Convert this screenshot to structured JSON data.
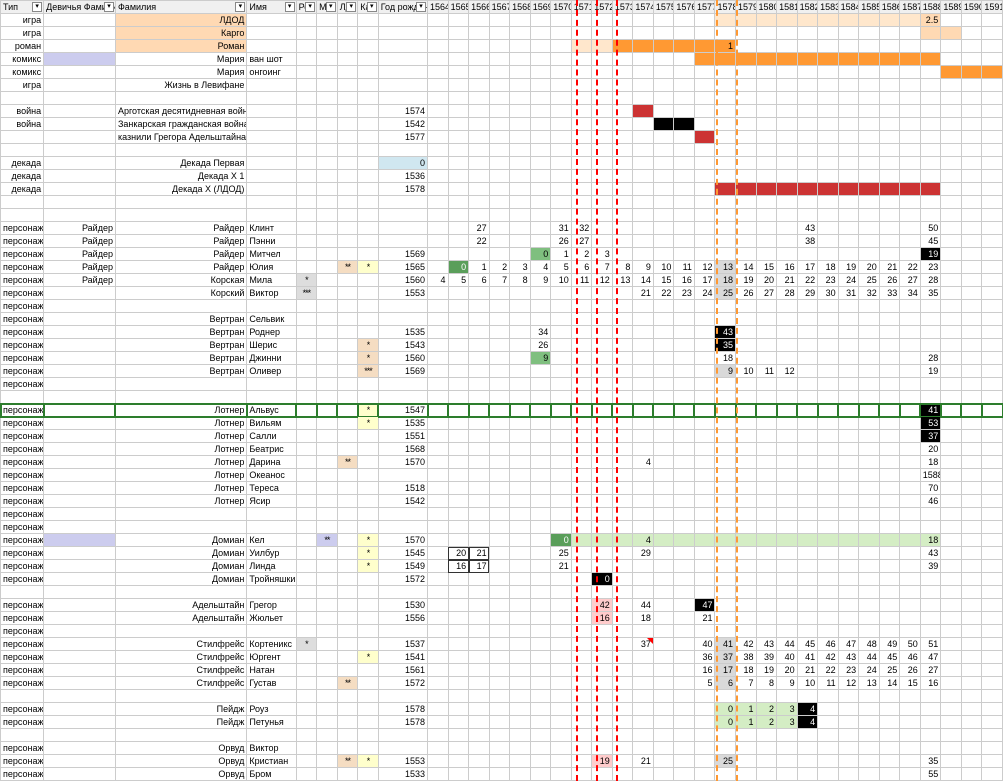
{
  "headers": [
    "Тип",
    "Девичья Фамилия",
    "Фамилия",
    "Имя",
    "Рок",
    "Ма",
    "ЛД",
    "Ка",
    "Год рожден"
  ],
  "years": [
    "1564",
    "1565",
    "1566",
    "1567",
    "1568",
    "1569",
    "1570",
    "1571",
    "1572",
    "1573",
    "1574",
    "1575",
    "1576",
    "1577",
    "1578",
    "1579",
    "1580",
    "1581",
    "1582",
    "1583",
    "1584",
    "1585",
    "1586",
    "1587",
    "1588",
    "1589",
    "1590",
    "1591"
  ],
  "rows": [
    {
      "t": "игра",
      "fam": "ЛДОД",
      "fcls": "bg-peach",
      "yr": {
        "1588": {
          "v": "2.5",
          "cls": "bg-peach"
        }
      },
      "span1": {
        "from": "1578",
        "to": "1587",
        "cls": "bg-peach2"
      }
    },
    {
      "t": "игра",
      "fam": "Карго",
      "fcls": "bg-peach",
      "span1": {
        "from": "1588",
        "to": "1589",
        "cls": "bg-peach"
      }
    },
    {
      "t": "роман",
      "fam": "Роман",
      "fcls": "bg-peach",
      "yr": {
        "1578": {
          "v": "1",
          "cls": "bg-orange"
        }
      },
      "span1": {
        "from": "1573",
        "to": "1577",
        "cls": "bg-orange"
      },
      "span0": {
        "from": "1571",
        "to": "1572",
        "cls": "bg-peach2"
      }
    },
    {
      "t": "комикс",
      "mfcls": "bg-lav",
      "fam": "Мария",
      "name": "ван шот",
      "span1": {
        "from": "1577",
        "to": "1588",
        "cls": "bg-orange"
      }
    },
    {
      "t": "комикс",
      "fam": "Мария",
      "name": "онгоинг",
      "span1": {
        "from": "1589",
        "to": "1591",
        "cls": "bg-orange"
      }
    },
    {
      "t": "игра",
      "fam": "Жизнь в Левифане"
    },
    {
      "t": ""
    },
    {
      "t": "война",
      "fam": "Арготская десятидневная война",
      "by": "1574",
      "span1": {
        "from": "1574",
        "to": "1574",
        "cls": "bg-red"
      }
    },
    {
      "t": "война",
      "fam": "Занкарская гражданская война",
      "by": "1542",
      "span1": {
        "from": "1575",
        "to": "1576",
        "cls": "bg-black"
      }
    },
    {
      "t": "",
      "fam": "казнили Грегора Адельштайна",
      "by": "1577",
      "span1": {
        "from": "1577",
        "to": "1577",
        "cls": "bg-red"
      }
    },
    {
      "t": ""
    },
    {
      "t": "декада",
      "fam": "Декада Первая",
      "by": "0",
      "bycls": "bg-lblue"
    },
    {
      "t": "декада",
      "fam": "Декада X 1",
      "by": "1536"
    },
    {
      "t": "декада",
      "fam": "Декада X (ЛДОД)",
      "by": "1578",
      "span1": {
        "from": "1578",
        "to": "1588",
        "cls": "bg-red"
      }
    },
    {
      "t": ""
    },
    {
      "t": ""
    },
    {
      "t": "персонаж",
      "mf": "Райдер",
      "fam": "Райдер",
      "name": "Клинт",
      "yr": {
        "1566": {
          "v": "27"
        },
        "1570": {
          "v": "31"
        },
        "1571": {
          "v": "32"
        },
        "1582": {
          "v": "43"
        },
        "1588": {
          "v": "50"
        }
      }
    },
    {
      "t": "персонаж",
      "mf": "Райдер",
      "fam": "Райдер",
      "name": "Пэнни",
      "yr": {
        "1566": {
          "v": "22"
        },
        "1570": {
          "v": "26"
        },
        "1571": {
          "v": "27"
        },
        "1582": {
          "v": "38"
        },
        "1588": {
          "v": "45"
        }
      }
    },
    {
      "t": "персонаж",
      "mf": "Райдер",
      "fam": "Райдер",
      "name": "Митчел",
      "by": "1569",
      "yr": {
        "1569": {
          "v": "0",
          "cls": "bg-green"
        },
        "1570": {
          "v": "1"
        },
        "1571": {
          "v": "2"
        },
        "1572": {
          "v": "3"
        },
        "1588": {
          "v": "19",
          "cls": "bg-black"
        }
      }
    },
    {
      "t": "персонаж",
      "mf": "Райдер",
      "fam": "Райдер",
      "name": "Юлия",
      "ld": "**",
      "ldcls": "bg-beige",
      "ka": "*",
      "kacls": "bg-yellow",
      "by": "1565",
      "yr": {
        "1565": {
          "v": "0",
          "cls": "bg-dgreen"
        },
        "1566": {
          "v": "1"
        },
        "1567": {
          "v": "2"
        },
        "1568": {
          "v": "3"
        },
        "1569": {
          "v": "4"
        },
        "1570": {
          "v": "5"
        },
        "1571": {
          "v": "6"
        },
        "1572": {
          "v": "7"
        },
        "1573": {
          "v": "8"
        },
        "1574": {
          "v": "9"
        },
        "1575": {
          "v": "10"
        },
        "1576": {
          "v": "11"
        },
        "1577": {
          "v": "12"
        },
        "1578": {
          "v": "13",
          "cls": "bg-greyf"
        },
        "1579": {
          "v": "14"
        },
        "1580": {
          "v": "15"
        },
        "1581": {
          "v": "16"
        },
        "1582": {
          "v": "17"
        },
        "1583": {
          "v": "18"
        },
        "1584": {
          "v": "19"
        },
        "1585": {
          "v": "20"
        },
        "1586": {
          "v": "21"
        },
        "1587": {
          "v": "22"
        },
        "1588": {
          "v": "23"
        }
      }
    },
    {
      "t": "персонаж",
      "mf": "Райдер",
      "fam": "Корская",
      "name": "Мила",
      "pok": "*",
      "pokcls": "bg-grey",
      "by": "1560",
      "yr": {
        "1564": {
          "v": "4"
        },
        "1565": {
          "v": "5"
        },
        "1566": {
          "v": "6"
        },
        "1567": {
          "v": "7"
        },
        "1568": {
          "v": "8"
        },
        "1569": {
          "v": "9"
        },
        "1570": {
          "v": "10"
        },
        "1571": {
          "v": "11"
        },
        "1572": {
          "v": "12"
        },
        "1573": {
          "v": "13"
        },
        "1574": {
          "v": "14"
        },
        "1575": {
          "v": "15"
        },
        "1576": {
          "v": "16"
        },
        "1577": {
          "v": "17"
        },
        "1578": {
          "v": "18",
          "cls": "bg-greyf"
        },
        "1579": {
          "v": "19"
        },
        "1580": {
          "v": "20"
        },
        "1581": {
          "v": "21"
        },
        "1582": {
          "v": "22"
        },
        "1583": {
          "v": "23"
        },
        "1584": {
          "v": "24"
        },
        "1585": {
          "v": "25"
        },
        "1586": {
          "v": "26"
        },
        "1587": {
          "v": "27"
        },
        "1588": {
          "v": "28"
        }
      }
    },
    {
      "t": "персонаж",
      "fam": "Корский",
      "name": "Виктор",
      "pok": "***",
      "pokcls": "bg-grey",
      "by": "1553",
      "yr": {
        "1574": {
          "v": "21"
        },
        "1575": {
          "v": "22"
        },
        "1576": {
          "v": "23"
        },
        "1577": {
          "v": "24"
        },
        "1578": {
          "v": "25",
          "cls": "bg-greyf"
        },
        "1579": {
          "v": "26"
        },
        "1580": {
          "v": "27"
        },
        "1581": {
          "v": "28"
        },
        "1582": {
          "v": "29"
        },
        "1583": {
          "v": "30"
        },
        "1584": {
          "v": "31"
        },
        "1585": {
          "v": "32"
        },
        "1586": {
          "v": "33"
        },
        "1587": {
          "v": "34"
        },
        "1588": {
          "v": "35"
        }
      }
    },
    {
      "t": "персонаж"
    },
    {
      "t": "персонаж",
      "fam": "Вертран",
      "name": "Сельвик"
    },
    {
      "t": "персонаж",
      "fam": "Вертран",
      "name": "Роднер",
      "by": "1535",
      "yr": {
        "1569": {
          "v": "34"
        },
        "1578": {
          "v": "43",
          "cls": "bg-black"
        }
      }
    },
    {
      "t": "персонаж",
      "fam": "Вертран",
      "name": "Шерис",
      "ka": "*",
      "kacls": "bg-beige",
      "by": "1543",
      "yr": {
        "1569": {
          "v": "26"
        },
        "1578": {
          "v": "35",
          "cls": "bg-black"
        }
      }
    },
    {
      "t": "персонаж",
      "fam": "Вертран",
      "name": "Джинни",
      "ka": "*",
      "kacls": "bg-beige",
      "by": "1560",
      "yr": {
        "1569": {
          "v": "9",
          "cls": "bg-green"
        },
        "1578": {
          "v": "18"
        },
        "1588": {
          "v": "28"
        }
      }
    },
    {
      "t": "персонаж",
      "fam": "Вертран",
      "name": "Оливер",
      "ka": "***",
      "kacls": "bg-beige",
      "by": "1569",
      "yr": {
        "1578": {
          "v": "9",
          "cls": "bg-greyf"
        },
        "1579": {
          "v": "10"
        },
        "1580": {
          "v": "11"
        },
        "1581": {
          "v": "12"
        },
        "1588": {
          "v": "19"
        }
      }
    },
    {
      "t": "персонаж"
    },
    {
      "t": ""
    },
    {
      "t": "персонаж",
      "fam": "Лотнер",
      "name": "Альвус",
      "ka": "*",
      "kacls": "bg-yellow",
      "by": "1547",
      "sel": true,
      "yr": {
        "1588": {
          "v": "41",
          "cls": "bg-black"
        }
      }
    },
    {
      "t": "персонаж",
      "fam": "Лотнер",
      "name": "Вильям",
      "ka": "*",
      "kacls": "bg-yellow",
      "by": "1535",
      "yr": {
        "1588": {
          "v": "53",
          "cls": "bg-black"
        }
      }
    },
    {
      "t": "персонаж",
      "fam": "Лотнер",
      "name": "Салли",
      "by": "1551",
      "yr": {
        "1588": {
          "v": "37",
          "cls": "bg-black"
        }
      }
    },
    {
      "t": "персонаж",
      "fam": "Лотнер",
      "name": "Беатрис",
      "by": "1568",
      "yr": {
        "1588": {
          "v": "20"
        }
      }
    },
    {
      "t": "персонаж",
      "fam": "Лотнер",
      "name": "Дарина",
      "ld": "**",
      "ldcls": "bg-beige",
      "by": "1570",
      "yr": {
        "1574": {
          "v": "4"
        },
        "1588": {
          "v": "18"
        }
      }
    },
    {
      "t": "персонаж",
      "fam": "Лотнер",
      "name": "Океанос",
      "yr": {
        "1588": {
          "v": "1588"
        }
      }
    },
    {
      "t": "персонаж",
      "fam": "Лотнер",
      "name": "Тереса",
      "by": "1518",
      "yr": {
        "1588": {
          "v": "70"
        }
      }
    },
    {
      "t": "персонаж",
      "fam": "Лотнер",
      "name": "Ясир",
      "by": "1542",
      "yr": {
        "1588": {
          "v": "46"
        }
      }
    },
    {
      "t": "персонаж"
    },
    {
      "t": "персонаж"
    },
    {
      "t": "персонаж",
      "mfcls": "bg-lav",
      "fam": "Домиан",
      "name": "Кел",
      "ma": "**",
      "macls": "bg-lav",
      "ka": "*",
      "kacls": "bg-yellow",
      "by": "1570",
      "yr": {
        "1570": {
          "v": "0",
          "cls": "bg-dgreen"
        },
        "1574": {
          "v": "4",
          "cls": "bg-lgreen"
        },
        "1588": {
          "v": "18",
          "cls": "bg-lgreen"
        }
      },
      "span1": {
        "from": "1571",
        "to": "1573",
        "cls": "bg-lgreen"
      },
      "span2": {
        "from": "1575",
        "to": "1587",
        "cls": "bg-lgreen"
      }
    },
    {
      "t": "персонаж",
      "fam": "Домиан",
      "name": "Уилбур",
      "ka": "*",
      "kacls": "bg-yellow",
      "by": "1545",
      "yr": {
        "1565": {
          "v": "20",
          "cls": "box-cell"
        },
        "1566": {
          "v": "21",
          "cls": "box-cell"
        },
        "1570": {
          "v": "25"
        },
        "1574": {
          "v": "29"
        },
        "1588": {
          "v": "43"
        }
      }
    },
    {
      "t": "персонаж",
      "fam": "Домиан",
      "name": "Линда",
      "ka": "*",
      "kacls": "bg-yellow",
      "by": "1549",
      "yr": {
        "1565": {
          "v": "16",
          "cls": "box-cell"
        },
        "1566": {
          "v": "17",
          "cls": "box-cell"
        },
        "1570": {
          "v": "21"
        },
        "1588": {
          "v": "39"
        }
      }
    },
    {
      "t": "персонаж",
      "fam": "Домиан",
      "name": "Тройняшки",
      "by": "1572",
      "yr": {
        "1572": {
          "v": "0",
          "cls": "bg-black"
        }
      }
    },
    {
      "t": ""
    },
    {
      "t": "персонаж",
      "fam": "Адельштайн",
      "name": "Грегор",
      "by": "1530",
      "yr": {
        "1572": {
          "v": "42",
          "cls": "bg-pink"
        },
        "1574": {
          "v": "44"
        },
        "1577": {
          "v": "47",
          "cls": "bg-black"
        }
      }
    },
    {
      "t": "персонаж",
      "fam": "Адельштайн",
      "name": "Жюльет",
      "by": "1556",
      "yr": {
        "1572": {
          "v": "16",
          "cls": "bg-pink"
        },
        "1574": {
          "v": "18"
        },
        "1577": {
          "v": "21"
        }
      }
    },
    {
      "t": "персонаж"
    },
    {
      "t": "персонаж",
      "fam": "Стилфрейс",
      "name": "Кортеникс",
      "pok": "*",
      "pokcls": "bg-grey",
      "by": "1537",
      "yr": {
        "1574": {
          "v": "37",
          "tri": true
        },
        "1577": {
          "v": "40"
        },
        "1578": {
          "v": "41",
          "cls": "bg-greyf"
        },
        "1579": {
          "v": "42"
        },
        "1580": {
          "v": "43"
        },
        "1581": {
          "v": "44"
        },
        "1582": {
          "v": "45"
        },
        "1583": {
          "v": "46"
        },
        "1584": {
          "v": "47"
        },
        "1585": {
          "v": "48"
        },
        "1586": {
          "v": "49"
        },
        "1587": {
          "v": "50"
        },
        "1588": {
          "v": "51"
        }
      }
    },
    {
      "t": "персонаж",
      "fam": "Стилфрейс",
      "name": "Юргент",
      "ka": "*",
      "kacls": "bg-yellow",
      "by": "1541",
      "yr": {
        "1577": {
          "v": "36"
        },
        "1578": {
          "v": "37",
          "cls": "bg-greyf"
        },
        "1579": {
          "v": "38"
        },
        "1580": {
          "v": "39"
        },
        "1581": {
          "v": "40"
        },
        "1582": {
          "v": "41"
        },
        "1583": {
          "v": "42"
        },
        "1584": {
          "v": "43"
        },
        "1585": {
          "v": "44"
        },
        "1586": {
          "v": "45"
        },
        "1587": {
          "v": "46"
        },
        "1588": {
          "v": "47"
        }
      }
    },
    {
      "t": "персонаж",
      "fam": "Стилфрейс",
      "name": "Натан",
      "by": "1561",
      "yr": {
        "1577": {
          "v": "16"
        },
        "1578": {
          "v": "17",
          "cls": "bg-greyf"
        },
        "1579": {
          "v": "18"
        },
        "1580": {
          "v": "19"
        },
        "1581": {
          "v": "20"
        },
        "1582": {
          "v": "21"
        },
        "1583": {
          "v": "22"
        },
        "1584": {
          "v": "23"
        },
        "1585": {
          "v": "24"
        },
        "1586": {
          "v": "25"
        },
        "1587": {
          "v": "26"
        },
        "1588": {
          "v": "27"
        }
      }
    },
    {
      "t": "персонаж",
      "fam": "Стилфрейс",
      "name": "Густав",
      "ld": "**",
      "ldcls": "bg-beige",
      "by": "1572",
      "yr": {
        "1577": {
          "v": "5"
        },
        "1578": {
          "v": "6",
          "cls": "bg-greyf"
        },
        "1579": {
          "v": "7"
        },
        "1580": {
          "v": "8"
        },
        "1581": {
          "v": "9"
        },
        "1582": {
          "v": "10"
        },
        "1583": {
          "v": "11"
        },
        "1584": {
          "v": "12"
        },
        "1585": {
          "v": "13"
        },
        "1586": {
          "v": "14"
        },
        "1587": {
          "v": "15"
        },
        "1588": {
          "v": "16"
        }
      }
    },
    {
      "t": ""
    },
    {
      "t": "персонаж",
      "fam": "Пейдж",
      "name": "Роуз",
      "by": "1578",
      "yr": {
        "1578": {
          "v": "0",
          "cls": "bg-lgreen"
        },
        "1579": {
          "v": "1",
          "cls": "bg-lgreen"
        },
        "1580": {
          "v": "2",
          "cls": "bg-lgreen"
        },
        "1581": {
          "v": "3",
          "cls": "bg-lgreen"
        },
        "1582": {
          "v": "4",
          "cls": "bg-black"
        }
      }
    },
    {
      "t": "персонаж",
      "fam": "Пейдж",
      "name": "Петунья",
      "by": "1578",
      "yr": {
        "1578": {
          "v": "0",
          "cls": "bg-lgreen"
        },
        "1579": {
          "v": "1",
          "cls": "bg-lgreen"
        },
        "1580": {
          "v": "2",
          "cls": "bg-lgreen"
        },
        "1581": {
          "v": "3",
          "cls": "bg-lgreen"
        },
        "1582": {
          "v": "4",
          "cls": "bg-black"
        }
      }
    },
    {
      "t": ""
    },
    {
      "t": "персонаж",
      "fam": "Орвуд",
      "name": "Виктор"
    },
    {
      "t": "персонаж",
      "fam": "Орвуд",
      "name": "Кристиан",
      "ld": "**",
      "ldcls": "bg-beige",
      "ka": "*",
      "kacls": "bg-yellow",
      "by": "1553",
      "yr": {
        "1572": {
          "v": "19",
          "cls": "bg-pink"
        },
        "1574": {
          "v": "21"
        },
        "1578": {
          "v": "25",
          "cls": "bg-greyf"
        },
        "1588": {
          "v": "35"
        }
      }
    },
    {
      "t": "персонаж",
      "fam": "Орвуд",
      "name": "Бром",
      "by": "1533",
      "yr": {
        "1588": {
          "v": "55"
        }
      }
    }
  ],
  "vlines_red": [
    "1571",
    "1572",
    "1573"
  ],
  "vlines_orange": [
    "1578",
    "1579"
  ]
}
